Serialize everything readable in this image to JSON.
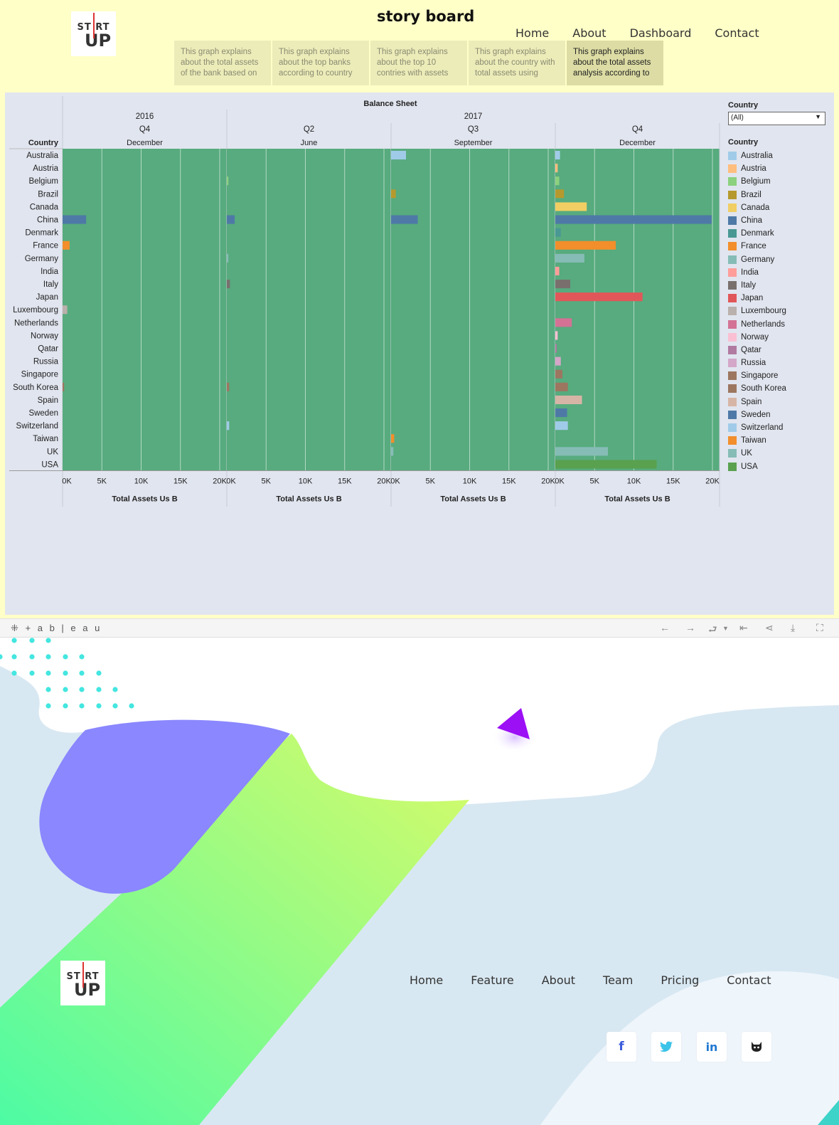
{
  "header": {
    "title": "story board",
    "logo": {
      "line1": "ST RT",
      "line2": "UP"
    },
    "nav": [
      "Home",
      "About",
      "Dashboard",
      "Contact"
    ]
  },
  "story_points": [
    {
      "text": "This graph explains about the total assets of the bank based on",
      "active": false
    },
    {
      "text": "This graph explains about the top banks according to country",
      "active": false
    },
    {
      "text": "This graph explains about the top 10 contries with assets",
      "active": false
    },
    {
      "text": "This graph explains about the country with total assets using",
      "active": false
    },
    {
      "text": "This graph explains about the total assets analysis according to",
      "active": true
    }
  ],
  "filter": {
    "title": "Country",
    "value": "(All)"
  },
  "legend": {
    "title": "Country",
    "items": [
      {
        "name": "Australia",
        "color": "#a0cbe8"
      },
      {
        "name": "Austria",
        "color": "#ffbe7d"
      },
      {
        "name": "Belgium",
        "color": "#8cd17d"
      },
      {
        "name": "Brazil",
        "color": "#b6992d"
      },
      {
        "name": "Canada",
        "color": "#f1ce63"
      },
      {
        "name": "China",
        "color": "#4e79a7"
      },
      {
        "name": "Denmark",
        "color": "#499894"
      },
      {
        "name": "France",
        "color": "#f28e2b"
      },
      {
        "name": "Germany",
        "color": "#86bcb6"
      },
      {
        "name": "India",
        "color": "#ff9d9a"
      },
      {
        "name": "Italy",
        "color": "#79706e"
      },
      {
        "name": "Japan",
        "color": "#e15759"
      },
      {
        "name": "Luxembourg",
        "color": "#bab0ac"
      },
      {
        "name": "Netherlands",
        "color": "#d37295"
      },
      {
        "name": "Norway",
        "color": "#fabfd2"
      },
      {
        "name": "Qatar",
        "color": "#b07aa1"
      },
      {
        "name": "Russia",
        "color": "#d4a6c8"
      },
      {
        "name": "Singapore",
        "color": "#9d7660"
      },
      {
        "name": "South Korea",
        "color": "#9d7660"
      },
      {
        "name": "Spain",
        "color": "#d7b5a6"
      },
      {
        "name": "Sweden",
        "color": "#4e79a7"
      },
      {
        "name": "Switzerland",
        "color": "#a0cbe8"
      },
      {
        "name": "Taiwan",
        "color": "#f28e2b"
      },
      {
        "name": "UK",
        "color": "#86bcb6"
      },
      {
        "name": "USA",
        "color": "#59a14f"
      }
    ]
  },
  "chart_data": {
    "type": "bar",
    "title": "Balance Sheet",
    "row_header": "Country",
    "xlabel": "Total Assets Us B",
    "xlim": [
      0,
      20000
    ],
    "x_ticks": [
      "0K",
      "5K",
      "10K",
      "15K",
      "20K"
    ],
    "background": "#57ab7e",
    "grid": true,
    "categories": [
      "Australia",
      "Austria",
      "Belgium",
      "Brazil",
      "Canada",
      "China",
      "Denmark",
      "France",
      "Germany",
      "India",
      "Italy",
      "Japan",
      "Luxembourg",
      "Netherlands",
      "Norway",
      "Qatar",
      "Russia",
      "Singapore",
      "South Korea",
      "Spain",
      "Sweden",
      "Switzerland",
      "Taiwan",
      "UK",
      "USA"
    ],
    "panels": [
      {
        "year": "2016",
        "quarter": "Q4",
        "month": "December",
        "values": [
          0,
          0,
          0,
          0,
          0,
          3000,
          0,
          900,
          0,
          0,
          0,
          0,
          600,
          0,
          0,
          0,
          0,
          0,
          200,
          0,
          0,
          0,
          0,
          0,
          0
        ]
      },
      {
        "year": "2017",
        "quarter": "Q2",
        "month": "June",
        "values": [
          0,
          0,
          200,
          0,
          0,
          1000,
          0,
          0,
          200,
          0,
          400,
          0,
          0,
          0,
          0,
          0,
          0,
          0,
          300,
          0,
          0,
          300,
          0,
          0,
          0
        ]
      },
      {
        "year": "2017",
        "quarter": "Q3",
        "month": "September",
        "values": [
          1900,
          0,
          0,
          600,
          0,
          3400,
          0,
          0,
          0,
          0,
          0,
          0,
          0,
          0,
          0,
          0,
          0,
          0,
          0,
          0,
          0,
          0,
          400,
          300,
          0
        ]
      },
      {
        "year": "2017",
        "quarter": "Q4",
        "month": "December",
        "values": [
          600,
          300,
          500,
          1100,
          4000,
          19900,
          700,
          7700,
          3700,
          500,
          1900,
          11100,
          0,
          2100,
          300,
          100,
          700,
          900,
          1600,
          3400,
          1500,
          1600,
          0,
          6700,
          12900
        ]
      }
    ]
  },
  "toolbar": {
    "brand": "+ a b | e a u"
  },
  "footer": {
    "logo": {
      "line1": "ST RT",
      "line2": "UP"
    },
    "nav": [
      "Home",
      "Feature",
      "About",
      "Team",
      "Pricing",
      "Contact"
    ],
    "social": [
      {
        "icon": "facebook-icon",
        "glyph": "f",
        "color": "#3b5bdb"
      },
      {
        "icon": "twitter-icon",
        "glyph": "🐦",
        "color": "#3bc3e8"
      },
      {
        "icon": "linkedin-icon",
        "glyph": "in",
        "color": "#1f78d1"
      },
      {
        "icon": "github-icon",
        "glyph": "🐱",
        "color": "#222"
      }
    ]
  }
}
